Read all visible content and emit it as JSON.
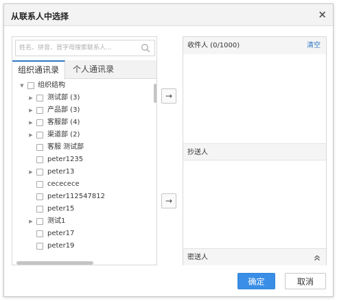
{
  "dialog": {
    "title": "从联系人中选择",
    "close_label": "×"
  },
  "search": {
    "placeholder": "姓名、拼音、首字母搜索联系人..."
  },
  "tabs": [
    {
      "label": "组织通讯录",
      "active": true
    },
    {
      "label": "个人通讯录",
      "active": false
    }
  ],
  "tree": {
    "items": [
      {
        "label": "组织结构",
        "expanded": true,
        "has_children": true
      },
      {
        "label": "测试部 (3)",
        "has_children": true
      },
      {
        "label": "产品部 (3)",
        "has_children": true
      },
      {
        "label": "客服部 (4)",
        "has_children": true
      },
      {
        "label": "渠道部 (2)",
        "has_children": true
      },
      {
        "label": "客服 测试部",
        "has_children": false
      },
      {
        "label": "peter1235",
        "has_children": false
      },
      {
        "label": "peter13",
        "has_children": true
      },
      {
        "label": "cececece",
        "has_children": false
      },
      {
        "label": "peter112547812",
        "has_children": false
      },
      {
        "label": "peter15",
        "has_children": false
      },
      {
        "label": "测试1",
        "has_children": true
      },
      {
        "label": "peter17",
        "has_children": false
      },
      {
        "label": "peter19",
        "has_children": false
      }
    ]
  },
  "move_buttons": {
    "to_recipients": "→",
    "to_cc": "→"
  },
  "right_panel": {
    "recipients_label": "收件人 (0/1000)",
    "clear_label": "清空",
    "cc_label": "抄送人",
    "bcc_label": "密送人",
    "bcc_toggle": "≈"
  },
  "footer": {
    "ok_label": "确定",
    "cancel_label": "取消"
  },
  "colors": {
    "accent": "#3a8ee6",
    "link": "#2f78c4",
    "header_bg": "#f3f3f3"
  },
  "icons": {
    "search": "search-icon",
    "move_right": "arrow-right-icon",
    "expand": "chevron-double-up-icon"
  }
}
